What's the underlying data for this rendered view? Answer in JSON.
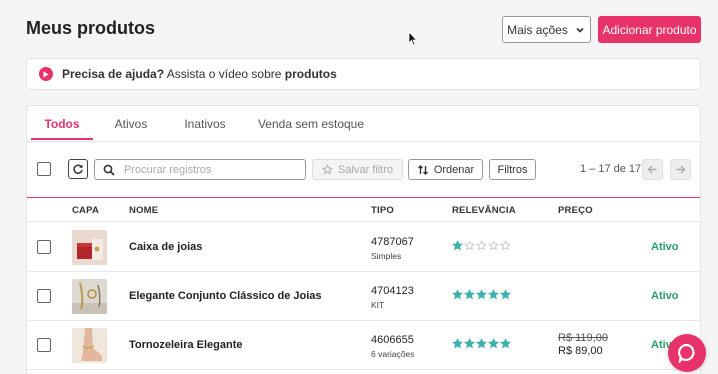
{
  "header": {
    "title": "Meus produtos",
    "more_actions_label": "Mais ações",
    "add_product_label": "Adicionar produto"
  },
  "help": {
    "bold_prefix": "Precisa de ajuda?",
    "text": " Assista o vídeo sobre ",
    "bold_suffix": "produtos"
  },
  "tabs": [
    {
      "label": "Todos",
      "active": true
    },
    {
      "label": "Ativos",
      "active": false
    },
    {
      "label": "Inativos",
      "active": false
    },
    {
      "label": "Venda sem estoque",
      "active": false
    }
  ],
  "toolbar": {
    "search_placeholder": "Procurar registros",
    "save_filter_label": "Salvar filtro",
    "sort_label": "Ordenar",
    "filters_label": "Filtros",
    "pagination": "1 – 17 de 17"
  },
  "columns": {
    "capa": "CAPA",
    "nome": "NOME",
    "tipo": "TIPO",
    "relevancia": "RELEVÂNCIA",
    "preco": "PREÇO"
  },
  "products": [
    {
      "name": "Caixa de joias",
      "code": "4787067",
      "type": "Simples",
      "rating": 1,
      "price_old": "",
      "price": "",
      "status": "Ativo",
      "thumb": "jewelry-box"
    },
    {
      "name": "Elegante Conjunto Clássico de Joias",
      "code": "4704123",
      "type": "KIT",
      "rating": 5,
      "price_old": "",
      "price": "",
      "status": "Ativo",
      "thumb": "jewelry-set"
    },
    {
      "name": "Tornozeleira Elegante",
      "code": "4606655",
      "type": "6 variações",
      "rating": 5,
      "price_old": "R$ 119,00",
      "price": "R$ 89,00",
      "status": "Ativo",
      "thumb": "anklet"
    }
  ],
  "colors": {
    "accent": "#e8336a",
    "star": "#3fb0ac",
    "status_active": "#2a9d6b"
  }
}
